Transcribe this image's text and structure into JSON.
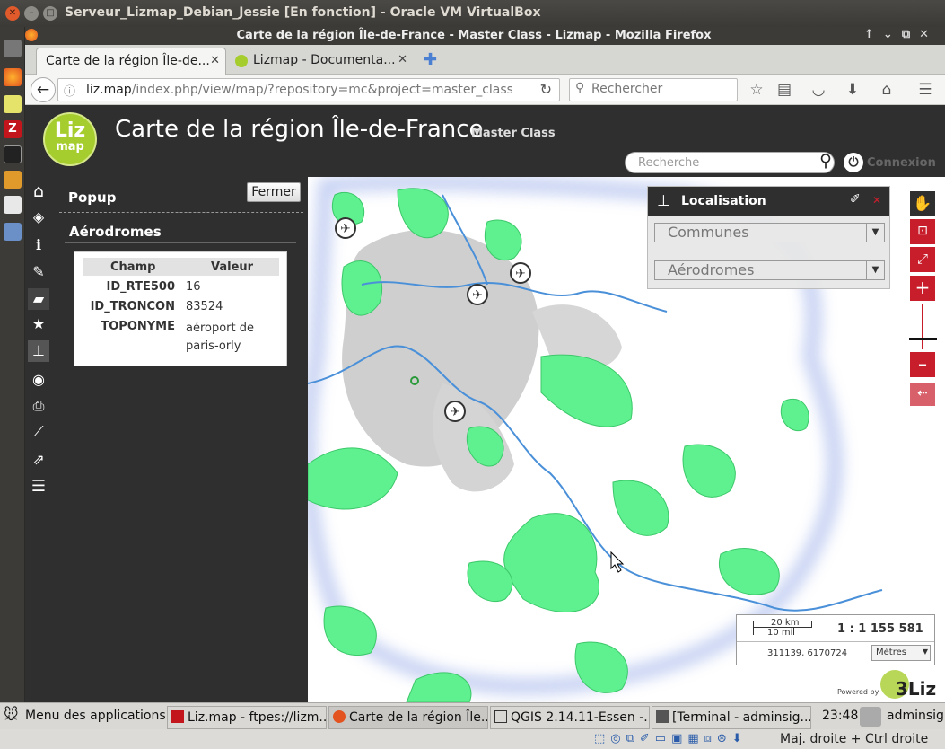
{
  "vbox": {
    "title": "Serveur_Lizmap_Debian_Jessie [En fonction] - Oracle VM VirtualBox"
  },
  "firefox": {
    "title": "Carte de la région Île-de-France - Master Class - Lizmap - Mozilla Firefox",
    "tabs": [
      {
        "label": "Carte de la région Île-de..."
      },
      {
        "label": "Lizmap - Documenta..."
      }
    ],
    "url_host": "liz.map",
    "url_path": "/index.php/view/map/?repository=mc&project=master_class_lizm",
    "search_placeholder": "Rechercher"
  },
  "lizmap": {
    "logo_top": "Liz",
    "logo_bottom": "map",
    "title": "Carte de la région Île-de-France",
    "subtitle": "Master Class",
    "search_placeholder": "Recherche",
    "login": "Connexion"
  },
  "popup": {
    "heading": "Popup",
    "close": "Fermer",
    "layer": "Aérodromes",
    "col_field": "Champ",
    "col_value": "Valeur",
    "rows": [
      {
        "field": "ID_RTE500",
        "value": "16"
      },
      {
        "field": "ID_TRONCON",
        "value": "83524"
      },
      {
        "field": "TOPONYME",
        "value": "aéroport de paris-orly"
      }
    ]
  },
  "locate": {
    "title": "Localisation",
    "select1": "Communes",
    "select2": "Aérodromes"
  },
  "scale": {
    "bar_km": "20 km",
    "bar_mi": "10 mi",
    "ratio": "1 : 1 155 581",
    "coords": "311139, 6170724",
    "unit": "Mètres"
  },
  "powered": {
    "label": "Powered by",
    "brand": "3Liz"
  },
  "taskbar": {
    "menu": "Menu des applications",
    "tasks": [
      "Liz.map - ftpes://lizm...",
      "Carte de la région Île...",
      "QGIS 2.14.11-Essen -...",
      "[Terminal - adminsig..."
    ],
    "clock": "23:48",
    "user": "adminsig"
  },
  "status": {
    "hostkey": "Maj. droite + Ctrl droite"
  },
  "colors": {
    "green": "#5ff08f",
    "urban": "#cfcfcf",
    "river": "#4a90d9",
    "accent": "#c81e2c",
    "vbox_bg": "#3c3b37"
  }
}
